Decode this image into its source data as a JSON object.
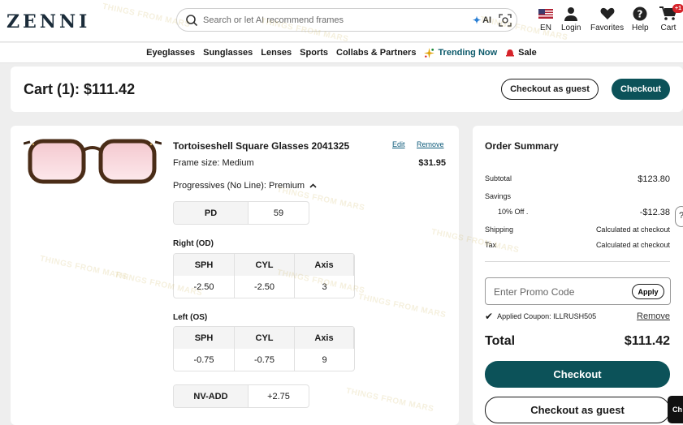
{
  "header": {
    "logo": "ZENNI",
    "search_placeholder": "Search or let AI recommend frames",
    "ai_label": "AI",
    "nav": [
      {
        "label": "EN",
        "icon": "us-flag-icon"
      },
      {
        "label": "Login",
        "icon": "user-icon"
      },
      {
        "label": "Favorites",
        "icon": "heart-icon"
      },
      {
        "label": "Help",
        "icon": "help-icon"
      },
      {
        "label": "Cart",
        "icon": "cart-icon",
        "badge": "+1"
      }
    ]
  },
  "categories": [
    "Eyeglasses",
    "Sunglasses",
    "Lenses",
    "Sports",
    "Collabs & Partners",
    "Trending Now",
    "Sale"
  ],
  "cart": {
    "title": "Cart (1): $111.42",
    "checkout_guest": "Checkout as guest",
    "checkout": "Checkout"
  },
  "item": {
    "name": "Tortoiseshell Square Glasses 2041325",
    "frame_size": "Frame size: Medium",
    "edit": "Edit",
    "remove": "Remove",
    "price": "$31.95",
    "lens": "Progressives (No Line): Premium",
    "pd": {
      "label": "PD",
      "value": "59"
    },
    "right_label": "Right (OD)",
    "left_label": "Left (OS)",
    "rx_headers": [
      "SPH",
      "CYL",
      "Axis"
    ],
    "right": [
      "-2.50",
      "-2.50",
      "3"
    ],
    "left": [
      "-0.75",
      "-0.75",
      "9"
    ],
    "nv_add": {
      "label": "NV-ADD",
      "value": "+2.75"
    }
  },
  "summary": {
    "title": "Order Summary",
    "subtotal_label": "Subtotal",
    "subtotal": "$123.80",
    "savings_label": "Savings",
    "discount_label": "10% Off .",
    "discount": "-$12.38",
    "shipping_label": "Shipping",
    "shipping": "Calculated at checkout",
    "tax_label": "Tax",
    "tax": "Calculated at checkout",
    "promo_placeholder": "Enter Promo Code",
    "apply": "Apply",
    "coupon": "Applied Coupon: ILLRUSH505",
    "coupon_remove": "Remove",
    "total_label": "Total",
    "total": "$111.42",
    "checkout": "Checkout",
    "checkout_guest": "Checkout as guest"
  },
  "side": {
    "chat": "Ch"
  },
  "watermark": "THINGS FROM MARS",
  "colors": {
    "brand": "#0c5259",
    "trending": "#0c5a6b",
    "badge": "#d6232a"
  }
}
